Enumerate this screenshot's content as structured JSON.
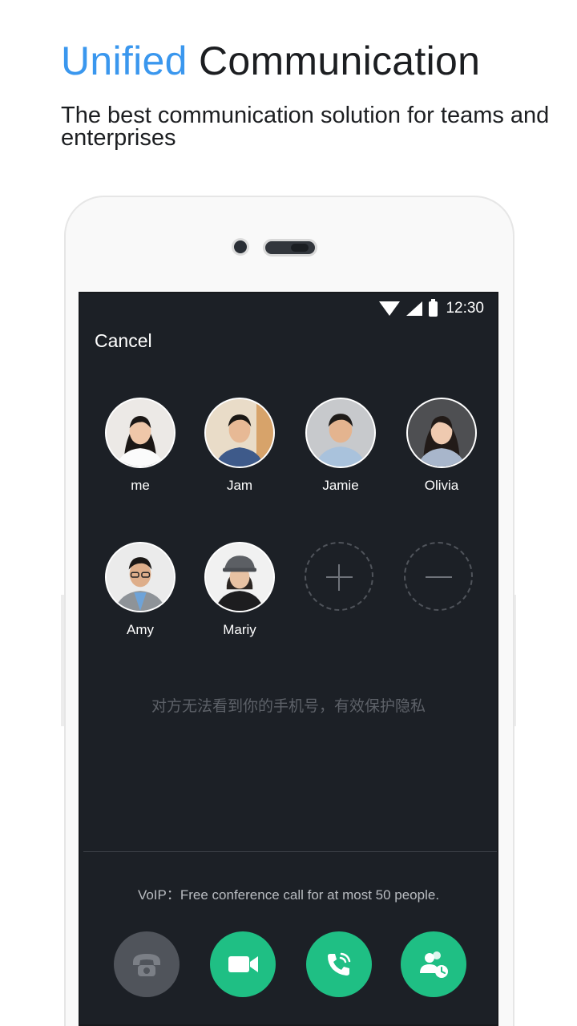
{
  "headline": {
    "accent": "Unified",
    "rest": "Communication"
  },
  "subheadline": "The best communication solution for teams and enterprises",
  "status_bar": {
    "time": "12:30",
    "icons": [
      "wifi-icon",
      "signal-icon",
      "battery-icon"
    ]
  },
  "nav": {
    "cancel_label": "Cancel"
  },
  "participants": [
    {
      "name": "me"
    },
    {
      "name": "Jam"
    },
    {
      "name": "Jamie"
    },
    {
      "name": "Olivia"
    },
    {
      "name": "Amy"
    },
    {
      "name": "Mariy"
    }
  ],
  "controls": {
    "add_icon": "plus-icon",
    "remove_icon": "minus-icon"
  },
  "privacy_note": "对方无法看到你的手机号，有效保护隐私",
  "voip_note": "VoIP：Free conference call for at most 50 people.",
  "actions": [
    {
      "icon": "hangup-phone-icon",
      "state": "disabled"
    },
    {
      "icon": "video-camera-icon",
      "state": "enabled"
    },
    {
      "icon": "voice-call-icon",
      "state": "enabled"
    },
    {
      "icon": "group-call-icon",
      "state": "enabled"
    }
  ],
  "colors": {
    "accent": "#3a97ee",
    "screen_bg": "#1c2026",
    "action_green": "#1fbf84",
    "action_disabled": "#50545b"
  }
}
